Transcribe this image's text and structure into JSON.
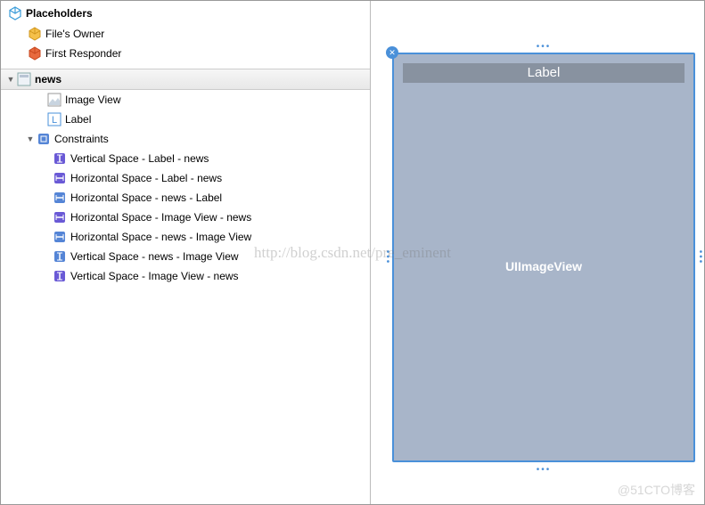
{
  "placeholders": {
    "header": "Placeholders",
    "filesOwner": "File's Owner",
    "firstResponder": "First Responder"
  },
  "outline": {
    "root": "news",
    "items": [
      "Image View",
      "Label"
    ],
    "constraintsHeader": "Constraints",
    "constraints": [
      "Vertical Space - Label - news",
      "Horizontal Space - Label - news",
      "Horizontal Space - news - Label",
      "Horizontal Space - Image View - news",
      "Horizontal Space - news - Image View",
      "Vertical Space - news - Image View",
      "Vertical Space - Image View - news"
    ]
  },
  "canvas": {
    "labelText": "Label",
    "imageViewText": "UIImageView"
  },
  "watermark": "http://blog.csdn.net/pre_eminent",
  "bottomWatermark": "@51CTO博客"
}
